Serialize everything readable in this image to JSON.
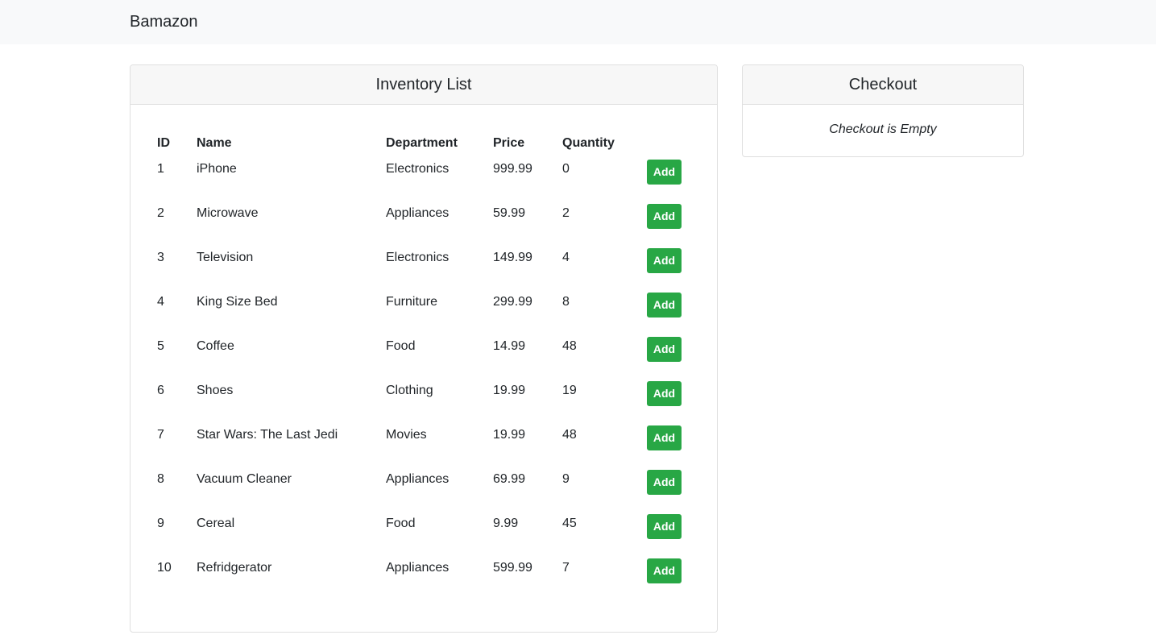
{
  "navbar": {
    "brand": "Bamazon"
  },
  "inventory": {
    "title": "Inventory List",
    "columns": [
      "ID",
      "Name",
      "Department",
      "Price",
      "Quantity",
      ""
    ],
    "add_label": "Add",
    "rows": [
      {
        "id": "1",
        "name": "iPhone",
        "department": "Electronics",
        "price": "999.99",
        "quantity": "0"
      },
      {
        "id": "2",
        "name": "Microwave",
        "department": "Appliances",
        "price": "59.99",
        "quantity": "2"
      },
      {
        "id": "3",
        "name": "Television",
        "department": "Electronics",
        "price": "149.99",
        "quantity": "4"
      },
      {
        "id": "4",
        "name": "King Size Bed",
        "department": "Furniture",
        "price": "299.99",
        "quantity": "8"
      },
      {
        "id": "5",
        "name": "Coffee",
        "department": "Food",
        "price": "14.99",
        "quantity": "48"
      },
      {
        "id": "6",
        "name": "Shoes",
        "department": "Clothing",
        "price": "19.99",
        "quantity": "19"
      },
      {
        "id": "7",
        "name": "Star Wars: The Last Jedi",
        "department": "Movies",
        "price": "19.99",
        "quantity": "48"
      },
      {
        "id": "8",
        "name": "Vacuum Cleaner",
        "department": "Appliances",
        "price": "69.99",
        "quantity": "9"
      },
      {
        "id": "9",
        "name": "Cereal",
        "department": "Food",
        "price": "9.99",
        "quantity": "45"
      },
      {
        "id": "10",
        "name": "Refridgerator",
        "department": "Appliances",
        "price": "599.99",
        "quantity": "7"
      }
    ]
  },
  "checkout": {
    "title": "Checkout",
    "empty_message": "Checkout is Empty"
  },
  "colors": {
    "navbar_bg": "#f8f9fa",
    "card_header_bg": "#f7f7f7",
    "add_button": "#28a745"
  }
}
